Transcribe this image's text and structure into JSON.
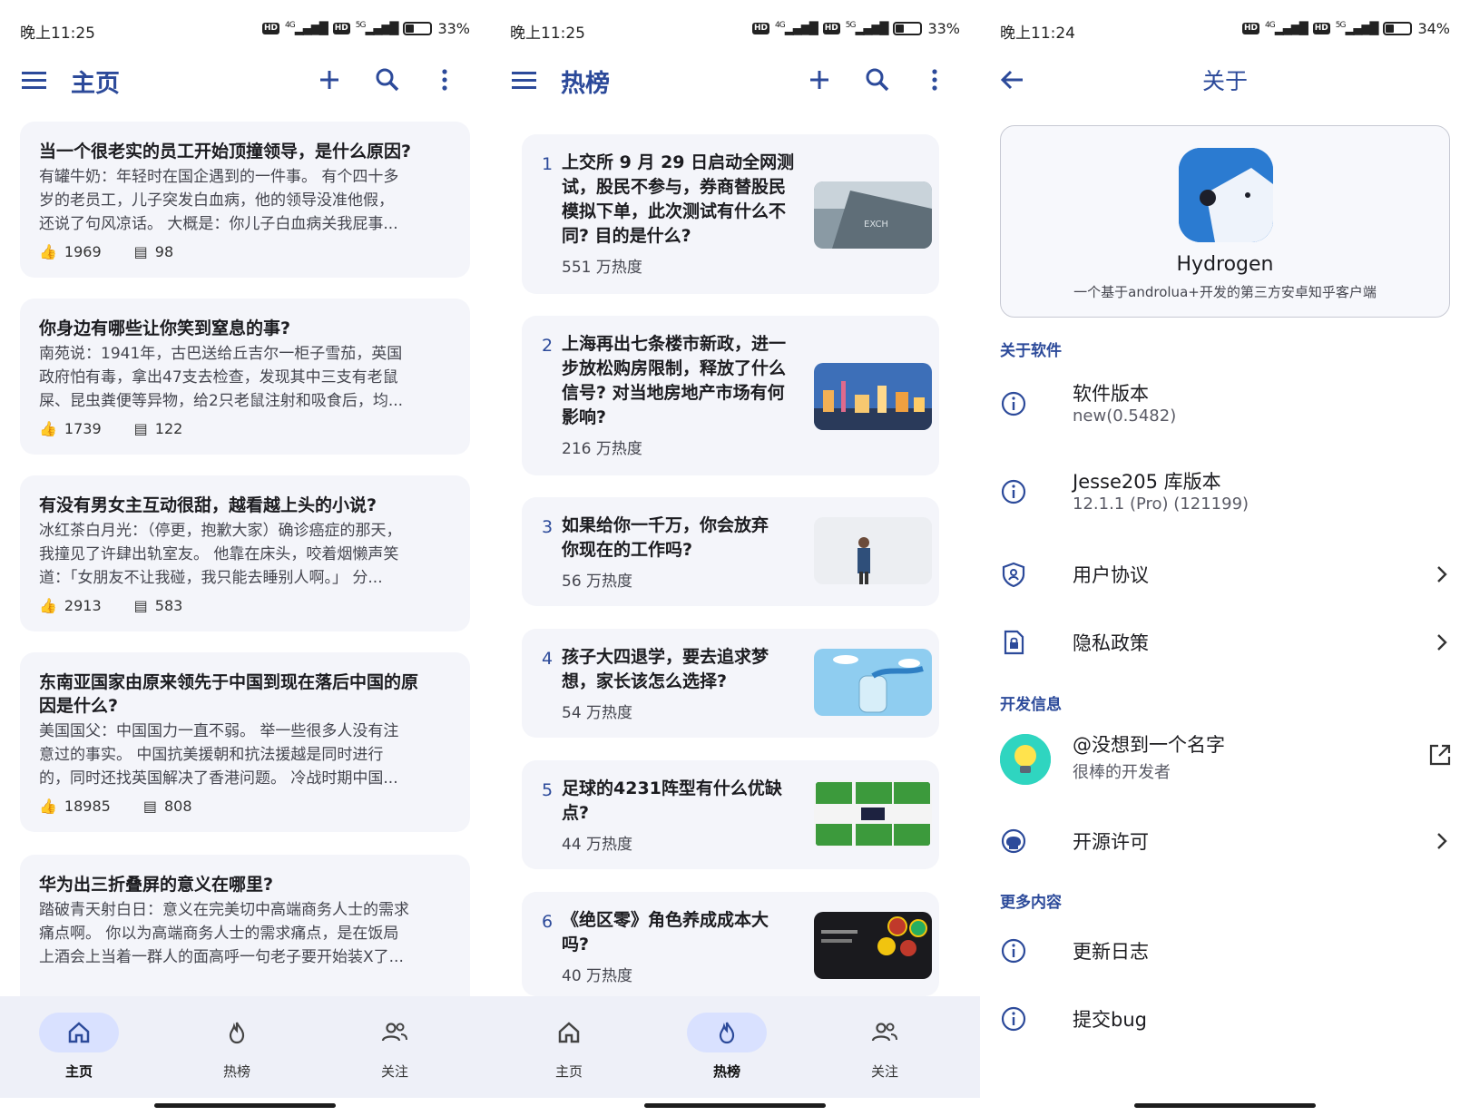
{
  "status_bars": [
    {
      "time": "晚上11:25",
      "battery": "33%",
      "battery_level": 0.33
    },
    {
      "time": "晚上11:25",
      "battery": "33%",
      "battery_level": 0.33
    },
    {
      "time": "晚上11:24",
      "battery": "34%",
      "battery_level": 0.34
    }
  ],
  "status_icons": {
    "hd": "HD",
    "net1": "4G",
    "net2": "5G"
  },
  "home": {
    "title": "主页",
    "cards": [
      {
        "question": "当一个很老实的员工开始顶撞领导，是什么原因?",
        "answer": [
          "有罐牛奶：年轻时在国企遇到的一件事。 有个四十多",
          "岁的老员工，儿子突发白血病，他的领导没准他假，",
          "还说了句风凉话。 大概是：你儿子白血病关我屁事..."
        ],
        "likes": "1969",
        "comments": "98"
      },
      {
        "question": "你身边有哪些让你笑到窒息的事?",
        "answer": [
          "南苑说：1941年，古巴送给丘吉尔一柜子雪茄，英国",
          "政府怕有毒，拿出47支去检查，发现其中三支有老鼠",
          "屎、昆虫粪便等异物，给2只老鼠注射和吸食后，均..."
        ],
        "likes": "1739",
        "comments": "122"
      },
      {
        "question": "有没有男女主互动很甜，越看越上头的小说?",
        "answer": [
          "冰红茶白月光：（停更，抱歉大家）确诊癌症的那天，",
          "我撞见了许肆出轨室友。 他靠在床头，咬着烟懒声笑",
          "道：「女朋友不让我碰，我只能去睡别人啊。」 分..."
        ],
        "likes": "2913",
        "comments": "583"
      },
      {
        "question": "东南亚国家由原来领先于中国到现在落后中国的原因是什么?",
        "question_lines": [
          "东南亚国家由原来领先于中国到现在落后中国的原",
          "因是什么?"
        ],
        "answer": [
          "美国国父：中国国力一直不弱。 举一些很多人没有注",
          "意过的事实。 中国抗美援朝和抗法援越是同时进行",
          "的，同时还找英国解决了香港问题。 冷战时期中国..."
        ],
        "likes": "18985",
        "comments": "808"
      },
      {
        "question": "华为出三折叠屏的意义在哪里?",
        "answer": [
          "踏破青天射白日：意义在完美切中高端商务人士的需求",
          "痛点啊。 你以为高端商务人士的需求痛点，是在饭局",
          "上酒会上当着一群人的面高呼一句老子要开始装X了..."
        ]
      }
    ]
  },
  "hot": {
    "title": "热榜",
    "items": [
      {
        "rank": "1",
        "lines": [
          "上交所 9 月 29 日启动全网测",
          "试，股民不参与，券商替股民",
          "模拟下单，此次测试有什么不",
          "同? 目的是什么?"
        ],
        "heat": "551 万热度"
      },
      {
        "rank": "2",
        "lines": [
          "上海再出七条楼市新政，进一",
          "步放松购房限制，释放了什么",
          "信号? 对当地房地产市场有何",
          "影响?"
        ],
        "heat": "216 万热度"
      },
      {
        "rank": "3",
        "lines": [
          "如果给你一千万，你会放弃",
          "你现在的工作吗?"
        ],
        "heat": "56 万热度"
      },
      {
        "rank": "4",
        "lines": [
          "孩子大四退学，要去追求梦",
          "想，家长该怎么选择?"
        ],
        "heat": "54 万热度"
      },
      {
        "rank": "5",
        "lines": [
          "足球的4231阵型有什么优缺",
          "点?"
        ],
        "heat": "44 万热度"
      },
      {
        "rank": "6",
        "lines": [
          "《绝区零》角色养成成本大",
          "吗?"
        ],
        "heat": "40 万热度"
      }
    ]
  },
  "nav": [
    {
      "label": "主页",
      "icon": "home-icon"
    },
    {
      "label": "热榜",
      "icon": "fire-icon"
    },
    {
      "label": "关注",
      "icon": "people-icon"
    }
  ],
  "about": {
    "title": "关于",
    "app_name": "Hydrogen",
    "app_desc": "一个基于androlua+开发的第三方安卓知乎客户端",
    "section_software": "关于软件",
    "section_dev": "开发信息",
    "section_more": "更多内容",
    "rows": {
      "version": {
        "title": "软件版本",
        "sub": "new(0.5482)"
      },
      "lib": {
        "title": "Jesse205 库版本",
        "sub": "12.1.1 (Pro) (121199)"
      },
      "agreement": {
        "title": "用户协议"
      },
      "privacy": {
        "title": "隐私政策"
      },
      "dev": {
        "title": "@没想到一个名字",
        "sub": "很棒的开发者"
      },
      "license": {
        "title": "开源许可"
      },
      "changelog": {
        "title": "更新日志"
      },
      "bug": {
        "title": "提交bug"
      }
    }
  },
  "colors": {
    "accent": "#2c4a9a",
    "card_bg": "#f4f5fa",
    "nav_bg": "#eef0f8",
    "nav_active": "#d9e1ff"
  }
}
